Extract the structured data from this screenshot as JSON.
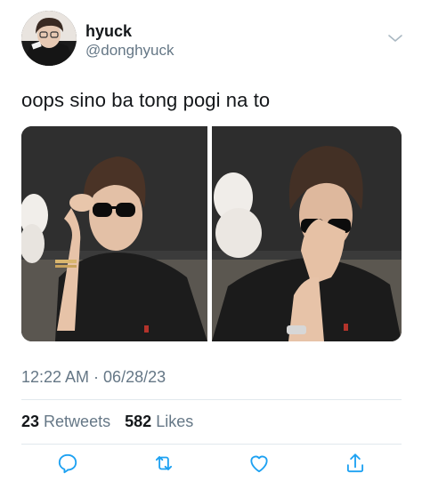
{
  "user": {
    "display_name": "hyuck",
    "handle": "@donghyuck"
  },
  "tweet": {
    "text": "oops sino ba tong pogi na to",
    "timestamp": "12:22 AM · 06/28/23",
    "media_count": 2
  },
  "stats": {
    "retweets_count": "23",
    "retweets_label": "Retweets",
    "likes_count": "582",
    "likes_label": "Likes"
  },
  "icons": {
    "more": "chevron-down-icon",
    "reply": "reply-icon",
    "retweet": "retweet-icon",
    "like": "heart-icon",
    "share": "share-icon"
  },
  "colors": {
    "primary_text": "#14171a",
    "secondary_text": "#657786",
    "divider": "#e1e8ed",
    "icon": "#1da1f2"
  }
}
